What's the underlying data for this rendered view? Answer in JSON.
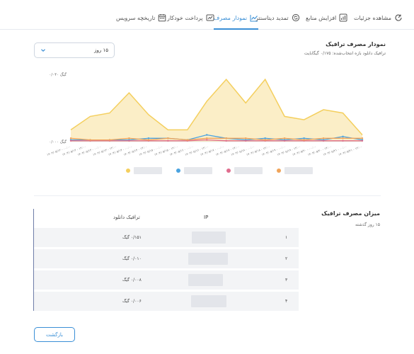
{
  "tabs": [
    {
      "label": "مشاهده جزئیات",
      "icon": "refresh-gauge-icon",
      "active": false
    },
    {
      "label": "افزایش منابع",
      "icon": "chart-up-icon",
      "active": false
    },
    {
      "label": "تمدید دیتاسنتر",
      "icon": "renew-icon",
      "active": false
    },
    {
      "label": "نمودار مصرف",
      "icon": "line-chart-icon",
      "active": true
    },
    {
      "label": "پرداخت خودکار",
      "icon": "auto-payment-icon",
      "active": false
    },
    {
      "label": "تاریخچه سرویس",
      "icon": "calendar-icon",
      "active": false
    }
  ],
  "chart_header": {
    "title": "نمودار مصرف ترافیک",
    "subtitle": "ترافیک دانلود بازه انتخاب‌شده: ۰/۱۷۵ گیگابایت"
  },
  "range_select": {
    "value": "۱۵ روز",
    "icon": "chevron-down-icon"
  },
  "chart_data": {
    "type": "area",
    "y_tick_labels": [
      "۰/۰۴۰ گیگ",
      "۰/۰۰۰ گیگ"
    ],
    "ylim": [
      0,
      0.04
    ],
    "x_tick_labels": [
      "۱۴۰۳/۰۵/۱۲ - ۰۰:۰۰",
      "۱۴۰۳/۰۵/۱۲ - ۱۲:۰۰",
      "۱۴۰۳/۰۵/۱۳ - ۰۰:۰۰",
      "۱۴۰۳/۰۵/۱۳ - ۱۲:۰۰",
      "۱۴۰۳/۰۵/۱۴ - ۰۰:۰۰",
      "۱۴۰۳/۰۵/۱۴ - ۱۲:۰۰",
      "۱۴۰۳/۰۵/۱۵ - ۰۰:۰۰",
      "۱۴۰۳/۰۵/۱۵ - ۱۲:۰۰",
      "۱۴۰۳/۰۵/۱۶ - ۰۰:۰۰",
      "۱۴۰۳/۰۵/۱۶ - ۱۲:۰۰",
      "۱۴۰۳/۰۵/۱۷ - ۰۰:۰۰",
      "۱۴۰۳/۰۵/۱۷ - ۱۲:۰۰",
      "۱۴۰۳/۰۵/۱۸ - ۰۰:۰۰",
      "۱۴۰۳/۰۵/۱۸ - ۱۲:۰۰",
      "۱۴۰۳/۰۵/۱۹ - ۰۰:۰۰",
      "۱۴۰۳/۰۵/۱۹ - ۱۲:۰۰",
      "۱۴۰۳/۰۵/۲۰ - ۰۰:۰۰",
      "۱۴۰۳/۰۵/۲۰ - ۱۲:۰۰",
      "۱۴۰۳/۰۵/۲۱ - ۰۰:۰۰",
      "۱۴۰۳/۰۵/۲۱ - ۱۲:۰۰"
    ],
    "series": [
      {
        "color": "#f4cf5e",
        "values": [
          0.007,
          0.015,
          0.017,
          0.029,
          0.016,
          0.007,
          0.007,
          0.024,
          0.037,
          0.023,
          0.037,
          0.015,
          0.013,
          0.019,
          0.017,
          0.004
        ]
      },
      {
        "color": "#4aa3e0",
        "values": [
          0.001,
          0.001,
          0.001,
          0.001,
          0.002,
          0.002,
          0.001,
          0.004,
          0.002,
          0.001,
          0.002,
          0.001,
          0.002,
          0.001,
          0.003,
          0.001
        ]
      },
      {
        "color": "#e06d8e",
        "values": [
          0.0005,
          0.0005,
          0.0005,
          0.0005,
          0.0005,
          0.0005,
          0.0005,
          0.001,
          0.0005,
          0.0005,
          0.0005,
          0.0005,
          0.0005,
          0.0005,
          0.0005,
          0.0005
        ]
      },
      {
        "color": "#f0a45a",
        "values": [
          0.002,
          0.001,
          0.001,
          0.002,
          0.001,
          0.002,
          0.001,
          0.002,
          0.002,
          0.002,
          0.001,
          0.002,
          0.001,
          0.002,
          0.002,
          0.002
        ]
      }
    ],
    "grid": false,
    "legend": "bottom"
  },
  "summary": {
    "title": "میزان مصرف ترافیک",
    "subtitle": "۱۵ روز گذشته"
  },
  "table": {
    "headers": {
      "ip": "IP",
      "download": "ترافیک دانلود"
    },
    "rows": [
      {
        "index": "۱",
        "download": "۰/۱۵۱ گیگ"
      },
      {
        "index": "۲",
        "download": "۰/۰۱۰ گیگ"
      },
      {
        "index": "۳",
        "download": "۰/۰۰۸ گیگ"
      },
      {
        "index": "۴",
        "download": "۰/۰۰۶ گیگ"
      }
    ]
  },
  "back_button": {
    "label": "بازگشت"
  }
}
